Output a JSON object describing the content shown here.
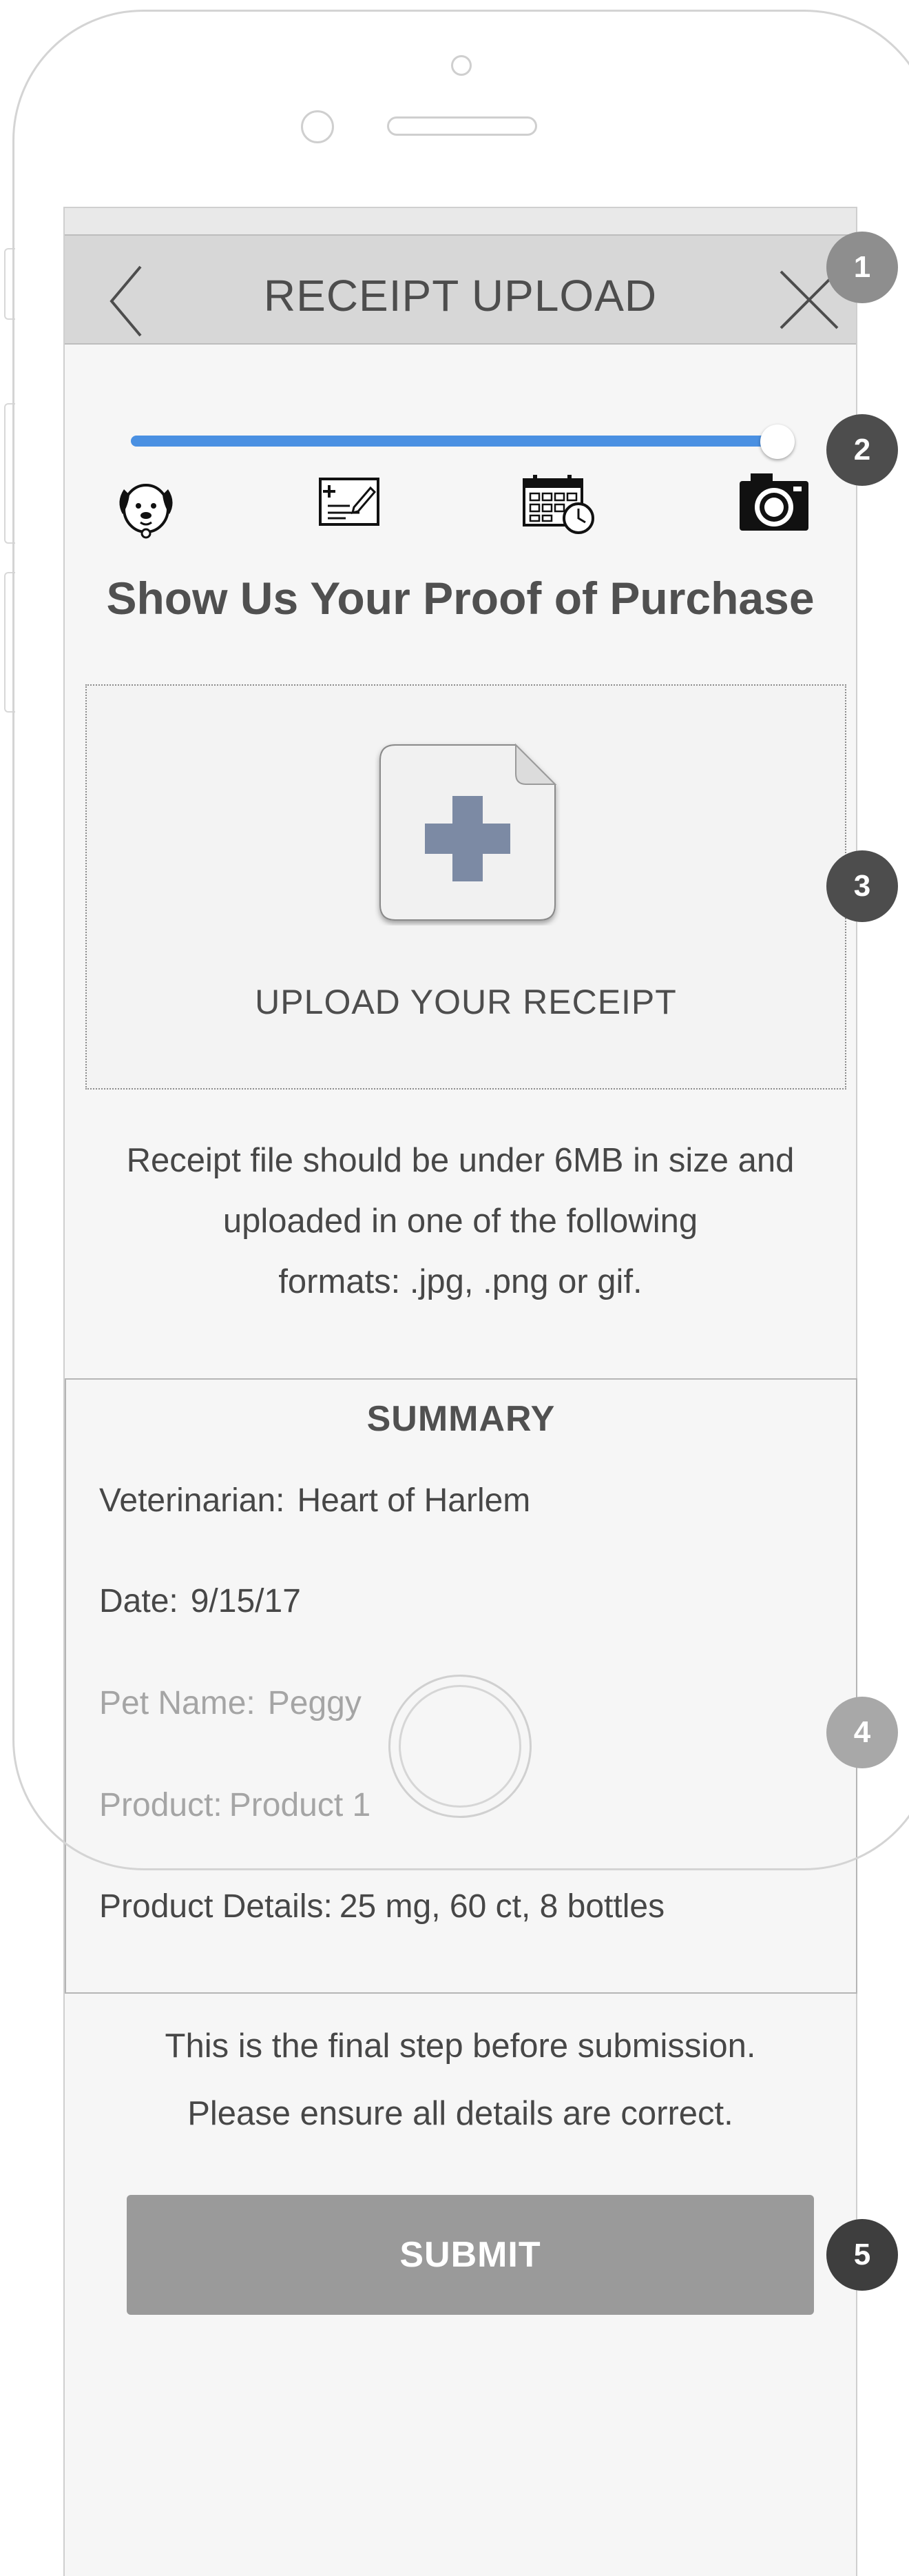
{
  "header": {
    "title": "RECEIPT UPLOAD",
    "back_icon": "chevron-left-icon",
    "close_icon": "close-icon"
  },
  "progress": {
    "value": 1.0,
    "color": "#4a90e2",
    "steps": [
      {
        "name": "pet",
        "icon": "dog-face-icon"
      },
      {
        "name": "vet-details",
        "icon": "medical-card-icon"
      },
      {
        "name": "date",
        "icon": "calendar-clock-icon"
      },
      {
        "name": "receipt",
        "icon": "camera-icon",
        "active": true
      }
    ]
  },
  "main": {
    "heading": "Show Us Your Proof of Purchase",
    "upload_label": "UPLOAD YOUR RECEIPT",
    "upload_icon": "add-file-icon",
    "guideline_lines": [
      "Receipt file should be under 6MB in size and",
      "uploaded in one of the following",
      "formats: .jpg, .png or gif."
    ]
  },
  "summary": {
    "title": "SUMMARY",
    "rows": [
      {
        "label": "Veterinarian:",
        "value": "Heart of Harlem"
      },
      {
        "label": "Date:",
        "value": "9/15/17"
      },
      {
        "label": "Pet Name:",
        "value": "Peggy"
      },
      {
        "label": "Product:",
        "value": "Product 1"
      },
      {
        "label": "Product Details:",
        "value": "25 mg, 60 ct, 8 bottles"
      }
    ]
  },
  "final_note": {
    "line1": "This is the final step before submission.",
    "line2": "Please ensure all details are correct."
  },
  "submit_label": "SUBMIT",
  "callouts": [
    {
      "num": "1",
      "color": "#8e8e8e"
    },
    {
      "num": "2",
      "color": "#4d4d4d"
    },
    {
      "num": "3",
      "color": "#4d4d4d"
    },
    {
      "num": "4",
      "color": "#a8a8a8"
    },
    {
      "num": "5",
      "color": "#3e3e3e"
    }
  ]
}
